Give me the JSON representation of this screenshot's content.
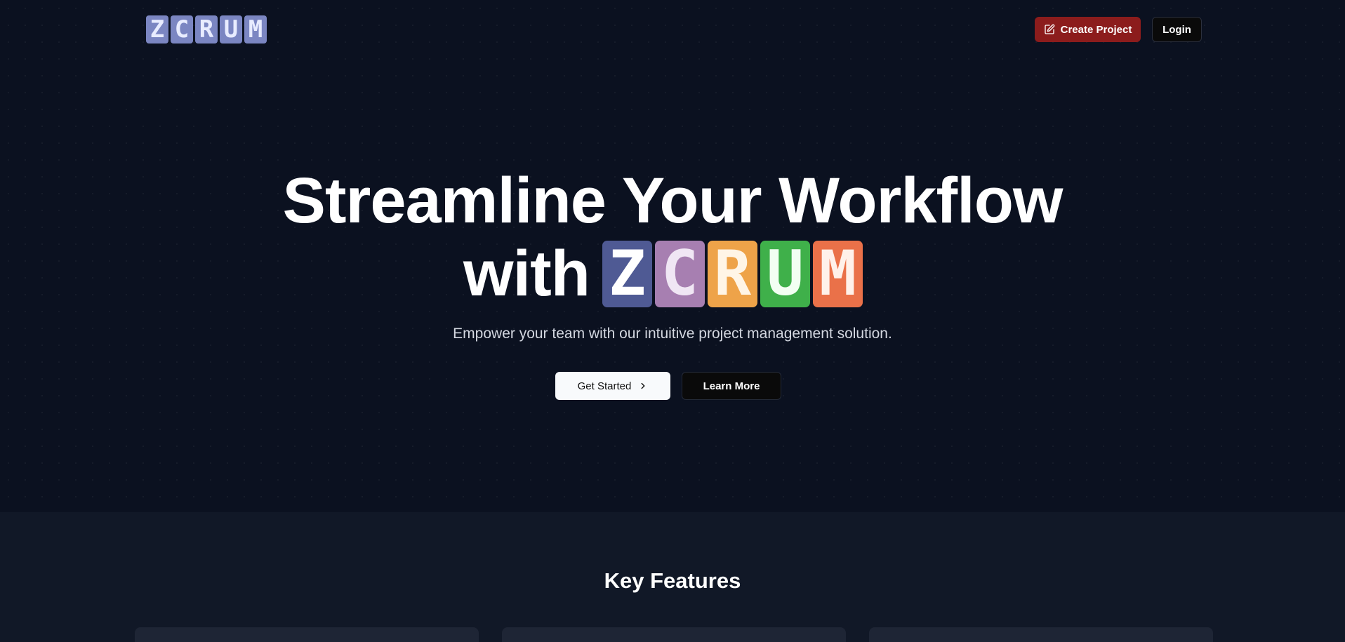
{
  "header": {
    "logo_letters": [
      "Z",
      "C",
      "R",
      "U",
      "M"
    ],
    "create_project_label": "Create Project",
    "login_label": "Login",
    "create_icon": "pencil-square-icon"
  },
  "hero": {
    "headline_line1": "Streamline Your Workflow",
    "headline_with": "with",
    "logo_letters": [
      {
        "letter": "Z",
        "bg": "#4f5a94",
        "fg": "#ffffff"
      },
      {
        "letter": "C",
        "bg": "#a77fb1",
        "fg": "#f0e6f4"
      },
      {
        "letter": "R",
        "bg": "#eea349",
        "fg": "#fff5e6"
      },
      {
        "letter": "U",
        "bg": "#3fb04a",
        "fg": "#f2fff2"
      },
      {
        "letter": "M",
        "bg": "#ea7149",
        "fg": "#fff1ea"
      }
    ],
    "subtitle": "Empower your team with our intuitive project management solution.",
    "get_started_label": "Get Started",
    "get_started_icon": "chevron-right-icon",
    "learn_more_label": "Learn More"
  },
  "features": {
    "title": "Key Features",
    "cards": [
      {},
      {},
      {}
    ]
  },
  "colors": {
    "background": "#0b1120",
    "features_bg": "#111827",
    "create_button": "#8c1c1c",
    "logo_tile": "#7b86c2"
  }
}
